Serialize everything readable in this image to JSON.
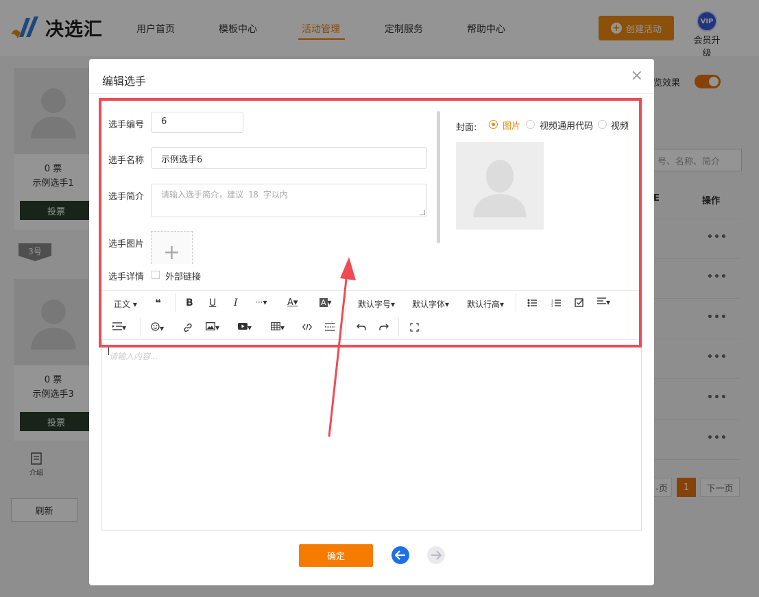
{
  "header": {
    "logo_text": "决选汇",
    "nav": [
      {
        "label": "用户首页",
        "active": false
      },
      {
        "label": "模板中心",
        "active": false
      },
      {
        "label": "活动管理",
        "active": true
      },
      {
        "label": "定制服务",
        "active": false
      },
      {
        "label": "帮助中心",
        "active": false
      }
    ],
    "create_button": "创建活动",
    "vip_badge": "VIP",
    "vip_label": "会员升级"
  },
  "background": {
    "cards": [
      {
        "votes": "0 票",
        "name": "示例选手1",
        "vote_button": "投票"
      },
      {
        "votes": "0 票",
        "name": "示例选手3",
        "vote_button": "投票"
      }
    ],
    "badge": "3号",
    "intro_tab": "介绍",
    "refresh_button": "刷新",
    "preview_label": "览效果",
    "search_placeholder": "号、名称、简介",
    "column_header": "操作",
    "column_header_partial": "E",
    "row_action": "•••",
    "pagination": {
      "prev": "-页",
      "current": "1",
      "next": "下一页"
    }
  },
  "modal": {
    "title": "编辑选手",
    "close_icon": "×",
    "fields": {
      "number_label": "选手编号",
      "number_value": "6",
      "name_label": "选手名称",
      "name_value": "示例选手6",
      "intro_label": "选手简介",
      "intro_placeholder": "请输入选手简介，建议 18 字以内",
      "image_label": "选手图片",
      "upload_plus": "+",
      "detail_label": "选手详情",
      "external_link_label": "外部链接"
    },
    "cover": {
      "label": "封面:",
      "options": [
        {
          "label": "图片",
          "checked": true
        },
        {
          "label": "视频通用代码",
          "checked": false
        },
        {
          "label": "视频",
          "checked": false
        }
      ]
    },
    "toolbar": {
      "paragraph": "正文",
      "quote": "❝",
      "bold": "B",
      "underline": "U",
      "italic": "I",
      "more": "···",
      "font_color": "A",
      "bg_color": "A",
      "font_size": "默认字号",
      "font_family": "默认字体",
      "line_height": "默认行高",
      "caret": "▾"
    },
    "editor_placeholder": "请输入内容...",
    "confirm_button": "确定"
  },
  "colors": {
    "accent": "#f57c00",
    "annotation": "#ef4b55",
    "back_arrow": "#1e6fe8"
  }
}
